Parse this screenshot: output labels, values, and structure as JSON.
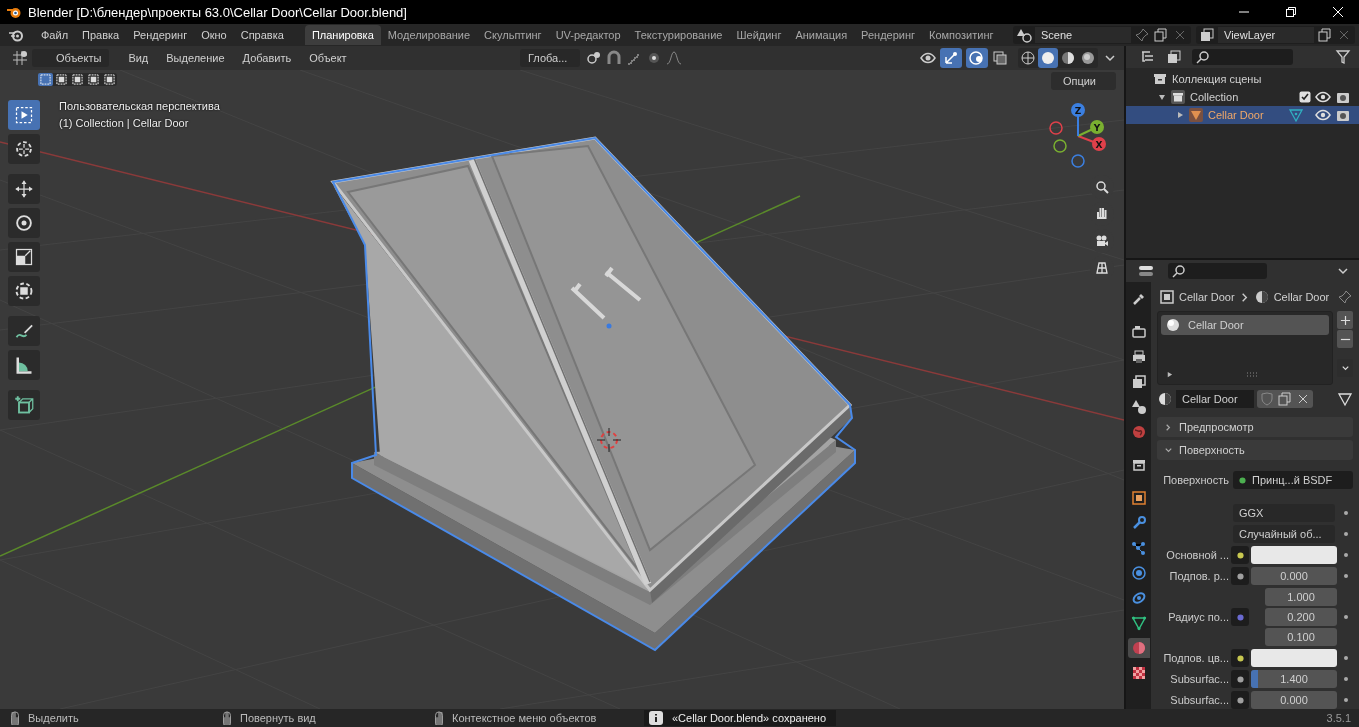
{
  "title_bar": {
    "title": "Blender [D:\\блендер\\проекты 63.0\\Cellar Door\\Cellar Door.blend]"
  },
  "menu": [
    "Файл",
    "Правка",
    "Рендеринг",
    "Окно",
    "Справка"
  ],
  "workspaces": [
    {
      "label": "Планировка",
      "selected": true
    },
    {
      "label": "Моделирование",
      "selected": false
    },
    {
      "label": "Скульптинг",
      "selected": false
    },
    {
      "label": "UV-редактор",
      "selected": false
    },
    {
      "label": "Текстурирование",
      "selected": false
    },
    {
      "label": "Шейдинг",
      "selected": false
    },
    {
      "label": "Анимация",
      "selected": false
    },
    {
      "label": "Рендеринг",
      "selected": false
    },
    {
      "label": "Композитинг",
      "selected": false
    }
  ],
  "scene": "Scene",
  "view_layer": "ViewLayer",
  "viewport": {
    "mode": "Объекты",
    "menus": [
      "Вид",
      "Выделение",
      "Добавить",
      "Объект"
    ],
    "orientation": "Глоба...",
    "options": "Опции",
    "view_name": "Пользовательская перспектива",
    "info": "(1) Collection | Cellar Door",
    "select_modes": [
      {
        "selected": true
      },
      {
        "selected": false
      },
      {
        "selected": false
      },
      {
        "selected": false
      },
      {
        "selected": false
      }
    ],
    "tools": [
      {
        "kind": "select-box",
        "selected": true
      },
      {
        "kind": "cursor",
        "selected": false
      },
      {
        "kind": "move",
        "selected": false
      },
      {
        "kind": "rotate",
        "selected": false
      },
      {
        "kind": "scale",
        "selected": false
      },
      {
        "kind": "transform",
        "selected": false
      },
      {
        "kind": "annotate",
        "selected": false
      },
      {
        "kind": "measure",
        "selected": false
      },
      {
        "kind": "add-cube",
        "selected": false
      }
    ],
    "gizmo_axes": [
      {
        "label": "X",
        "color": "#e0404a"
      },
      {
        "label": "Y",
        "color": "#7ab030"
      },
      {
        "label": "Z",
        "color": "#3b7fe0"
      }
    ],
    "gizmos_on": true,
    "overlays_on": true,
    "shading": [
      {
        "selected": false
      },
      {
        "selected": true
      },
      {
        "selected": false
      },
      {
        "selected": false
      }
    ]
  },
  "outliner": {
    "tree": [
      {
        "label": "Коллекция сцены",
        "kind": "scene-collection",
        "children": [
          {
            "label": "Collection",
            "kind": "collection",
            "expanded": true,
            "checked": true,
            "children": [
              {
                "label": "Cellar Door",
                "kind": "object",
                "expanded": false,
                "selected": true
              }
            ]
          }
        ]
      }
    ]
  },
  "properties": {
    "tabs": [
      {
        "kind": "tool",
        "selected": false
      },
      {
        "kind": "render",
        "selected": false
      },
      {
        "kind": "output",
        "selected": false
      },
      {
        "kind": "view-layer",
        "selected": false
      },
      {
        "kind": "scene",
        "selected": false
      },
      {
        "kind": "world",
        "selected": false
      },
      {
        "kind": "collection",
        "selected": false
      },
      {
        "kind": "object",
        "selected": false
      },
      {
        "kind": "modifier",
        "selected": false
      },
      {
        "kind": "particles",
        "selected": false
      },
      {
        "kind": "physics",
        "selected": false
      },
      {
        "kind": "constraints",
        "selected": false
      },
      {
        "kind": "data",
        "selected": false
      },
      {
        "kind": "material",
        "selected": true
      },
      {
        "kind": "texture",
        "selected": false
      }
    ],
    "breadcrumb": [
      "Cellar Door",
      "Cellar Door"
    ],
    "slots": [
      {
        "label": "Cellar Door",
        "selected": true
      }
    ],
    "material": "Cellar Door",
    "panels": [
      {
        "label": "Предпросмотр",
        "expanded": false
      },
      {
        "label": "Поверхность",
        "expanded": true,
        "fields": [
          {
            "kind": "shader",
            "label": "Поверхность",
            "value": "Принц...й BSDF",
            "color": "#4caf50"
          },
          {
            "kind": "dropdown",
            "value": "GGX"
          },
          {
            "kind": "dropdown",
            "value": "Случайный об..."
          },
          {
            "kind": "color",
            "label": "Основной ...",
            "color": "#c8c850"
          },
          {
            "kind": "number",
            "label": "Подпов. р...",
            "color": "#a0a0a0",
            "value": "0.000"
          },
          {
            "kind": "vector",
            "label": "Радиус по...",
            "color": "#6a6ad0",
            "values": [
              "1.000",
              "0.200",
              "0.100"
            ]
          },
          {
            "kind": "color",
            "label": "Подпов. цв...",
            "color": "#c8c850"
          },
          {
            "kind": "number",
            "label": "Subsurfac...",
            "color": "#a0a0a0",
            "value": "1.400",
            "level": 0.08
          },
          {
            "kind": "number",
            "label": "Subsurfac...",
            "color": "#a0a0a0",
            "value": "0.000"
          }
        ]
      }
    ]
  },
  "status_bar": {
    "hints": [
      {
        "label": "Выделить",
        "kind": "left-click"
      },
      {
        "label": "Повернуть вид",
        "kind": "middle-click"
      },
      {
        "label": "Контекстное меню объектов",
        "kind": "right-click"
      }
    ],
    "notification": "«Cellar Door.blend» сохранено",
    "version": "3.5.1"
  }
}
